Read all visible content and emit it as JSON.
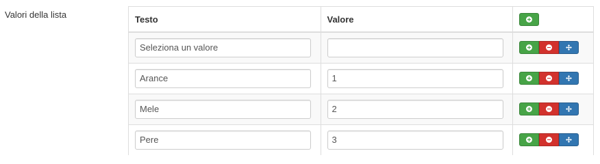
{
  "field": {
    "label": "Valori della lista"
  },
  "table": {
    "headers": {
      "text": "Testo",
      "value": "Valore"
    },
    "rows": [
      {
        "text": "Seleziona un valore",
        "value": ""
      },
      {
        "text": "Arance",
        "value": "1"
      },
      {
        "text": "Mele",
        "value": "2"
      },
      {
        "text": "Pere",
        "value": "3"
      }
    ]
  },
  "icons": {
    "add": "plus-circle-icon",
    "remove": "minus-circle-icon",
    "move": "move-arrows-icon"
  },
  "colors": {
    "success": "#47a447",
    "danger": "#d2322d",
    "primary": "#3276b1",
    "border": "#dddddd",
    "striped_row": "#f9f9f9"
  }
}
